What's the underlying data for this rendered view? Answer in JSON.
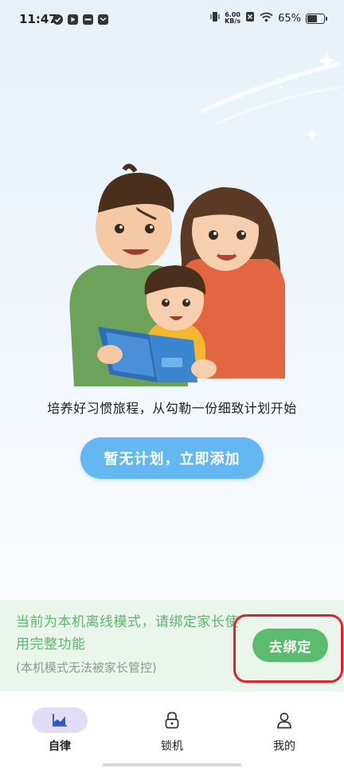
{
  "status_bar": {
    "time": "11:47",
    "net_speed_value": "6.00",
    "net_speed_unit": "KB/s",
    "battery_percent": "65%",
    "battery_level": 0.65,
    "left_icons": [
      "check-circle-icon",
      "play-app-icon",
      "app-icon",
      "mail-app-icon"
    ],
    "right_icons": [
      "vibrate-icon",
      "no-sim-icon",
      "wifi-icon",
      "battery-icon"
    ]
  },
  "main": {
    "slogan": "培养好习惯旅程，从勾勒一份细致计划开始",
    "add_plan_label": "暂无计划，立即添加"
  },
  "offline_banner": {
    "message": "当前为本机离线模式，请绑定家长使用完整功能",
    "note": "(本机模式无法被家长管控)",
    "bind_label": "去绑定"
  },
  "bottom_nav": {
    "items": [
      {
        "label": "自律",
        "icon": "chart-icon",
        "active": true
      },
      {
        "label": "锁机",
        "icon": "lock-icon",
        "active": false
      },
      {
        "label": "我的",
        "icon": "person-icon",
        "active": false
      }
    ]
  },
  "colors": {
    "primary_blue": "#63b8f2",
    "green": "#5cbc6d",
    "banner_bg": "#eaf6ec",
    "highlight_red": "#e0222b",
    "nav_active_bg": "#e3dcf7"
  }
}
